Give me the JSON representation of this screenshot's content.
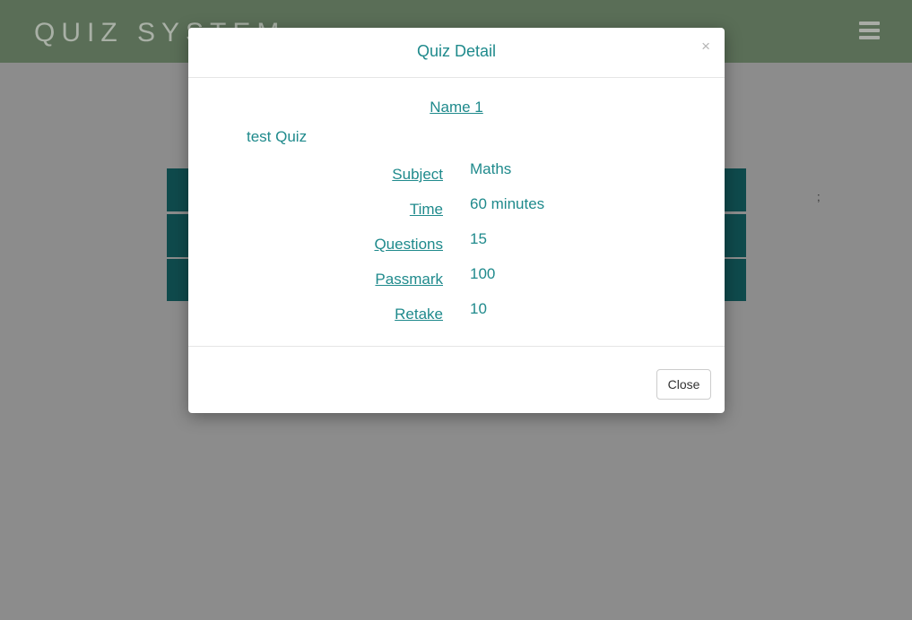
{
  "header": {
    "brand": "QUIZ SYSTEM",
    "menu_icon": "hamburger-menu-icon"
  },
  "background": {
    "stray_text": ";"
  },
  "modal": {
    "title": "Quiz Detail",
    "close_symbol": "×",
    "quiz_name": "Name 1",
    "quiz_description": "test Quiz",
    "details": [
      {
        "label": "Subject",
        "value": "Maths"
      },
      {
        "label": "Time",
        "value": "60 minutes"
      },
      {
        "label": "Questions",
        "value": "15"
      },
      {
        "label": "Passmark",
        "value": "100"
      },
      {
        "label": "Retake",
        "value": "10"
      }
    ],
    "close_button_label": "Close"
  },
  "colors": {
    "overlay": "#8c8c8c",
    "header": "#5a6e57",
    "accent_teal": "#1f8a8c",
    "table_row": "#0f4a4c"
  }
}
